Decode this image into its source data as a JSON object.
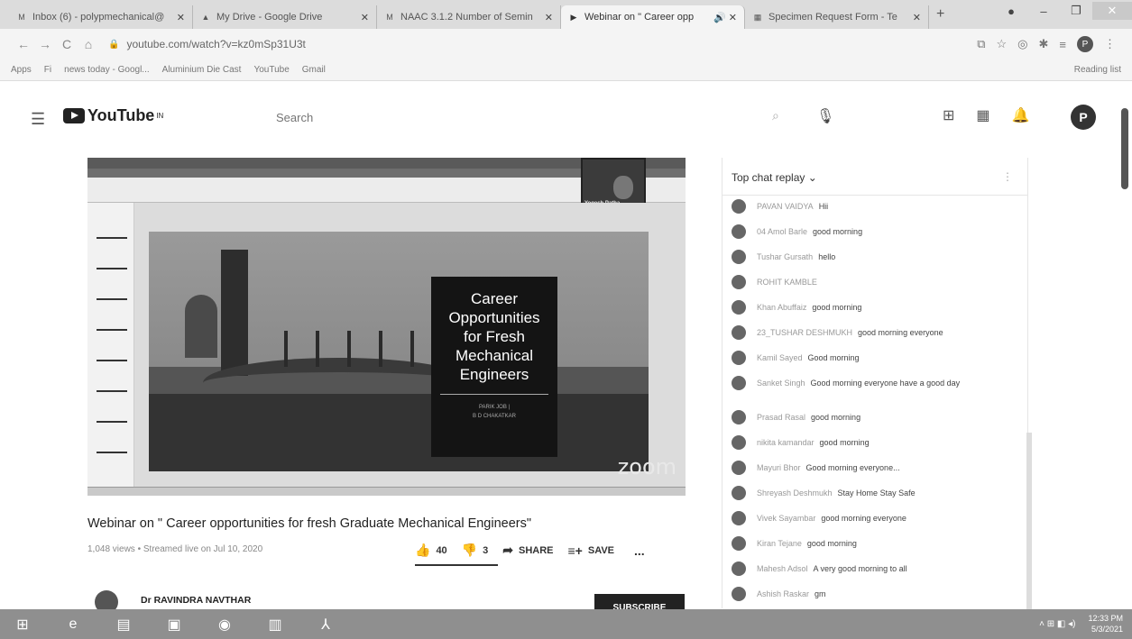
{
  "browser": {
    "tabs": [
      {
        "label": "Inbox (6) - polypmechanical@",
        "favicon": "M"
      },
      {
        "label": "My Drive - Google Drive",
        "favicon": "▲"
      },
      {
        "label": "NAAC 3.1.2 Number of Semin",
        "favicon": "M"
      },
      {
        "label": "Webinar on \" Career opp",
        "favicon": "▶"
      },
      {
        "label": "Specimen Request Form - Te",
        "favicon": "▦"
      }
    ],
    "new_tab": "+",
    "url": "youtube.com/watch?v=kz0mSp31U3t",
    "profile_initial": "P",
    "bookmarks": [
      "Apps",
      "Fi",
      "news today - Googl...",
      "Aluminium Die Cast",
      "YouTube",
      "Gmail"
    ],
    "reading_list": "Reading list"
  },
  "youtube": {
    "logo_text": "YouTube",
    "logo_sup": "IN",
    "search_placeholder": "Search",
    "avatar_initial": "P"
  },
  "video": {
    "slide_title_lines": [
      "Career",
      "Opportunities",
      "for Fresh",
      "Mechanical",
      "Engineers"
    ],
    "presenter_names": [
      "PARIK JOB |",
      "B D CHAKATKAR"
    ],
    "presenter_tile_name": "Yogesh Patha...",
    "watermark": "zoom",
    "title": "Webinar on \" Career opportunities for fresh Graduate Mechanical Engineers\"",
    "meta": "1,048 views • Streamed live on Jul 10, 2020",
    "likes": "40",
    "dislikes": "3",
    "share_label": "SHARE",
    "save_label": "SAVE",
    "more": "...",
    "channel_name": "Dr RAVINDRA NAVTHAR",
    "subscribe_label": "SUBSCRIBE"
  },
  "chat": {
    "header": "Top chat replay",
    "messages": [
      {
        "author": "PAVAN VAIDYA",
        "text": "Hii"
      },
      {
        "author": "04 Amol Barle",
        "text": "good morning"
      },
      {
        "author": "Tushar Gursath",
        "text": "hello"
      },
      {
        "author": "ROHIT KAMBLE",
        "text": ""
      },
      {
        "author": "Khan Abuffaiz",
        "text": "good morning"
      },
      {
        "author": "23_TUSHAR DESHMUKH",
        "text": "good morning everyone"
      },
      {
        "author": "Kamil Sayed",
        "text": "Good morning"
      },
      {
        "author": "Sanket Singh",
        "text": "Good morning everyone have a good day"
      },
      {
        "author": "Prasad Rasal",
        "text": "good morning"
      },
      {
        "author": "nikita kamandar",
        "text": "good morning"
      },
      {
        "author": "Mayuri Bhor",
        "text": "Good morning everyone..."
      },
      {
        "author": "Shreyash Deshmukh",
        "text": "Stay Home Stay Safe"
      },
      {
        "author": "Vivek Sayambar",
        "text": "good morning everyone"
      },
      {
        "author": "Kiran Tejane",
        "text": "good morning"
      },
      {
        "author": "Mahesh Adsol",
        "text": "A very good morning to all"
      },
      {
        "author": "Ashish Raskar",
        "text": "gm"
      }
    ]
  },
  "taskbar": {
    "clock_time": "12:33 PM",
    "clock_date": "5/3/2021"
  }
}
